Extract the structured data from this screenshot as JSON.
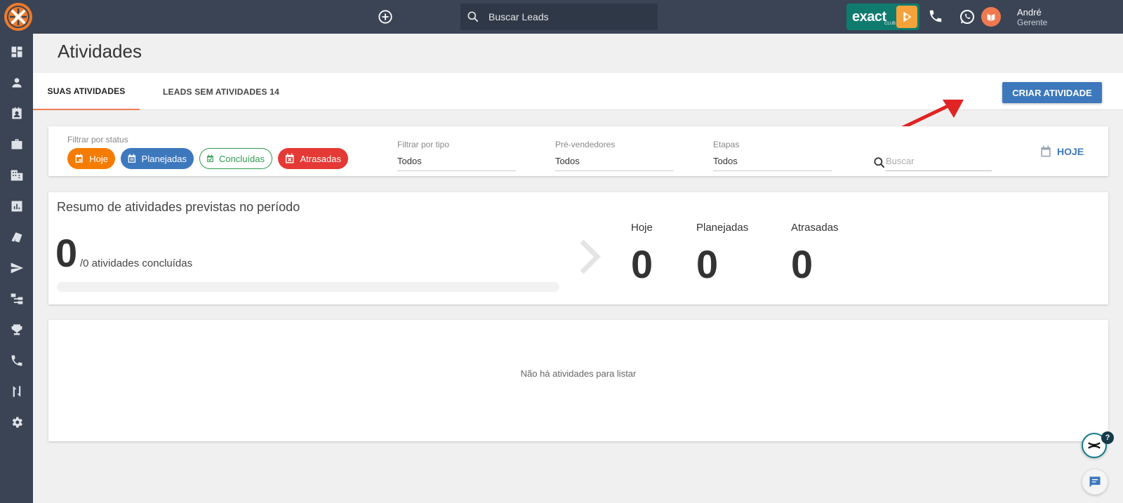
{
  "topbar": {
    "search_placeholder": "Buscar Leads",
    "brand_badge": "exact",
    "brand_badge_sub": "CLUB",
    "user_name": "André",
    "user_role": "Gerente"
  },
  "sidebar": {
    "items": [
      "dashboard-icon",
      "person-icon",
      "contact-card-icon",
      "briefcase-icon",
      "building-icon",
      "chart-icon",
      "tags-icon",
      "send-icon",
      "hierarchy-icon",
      "trophy-icon",
      "phone-icon",
      "sort-icon",
      "settings-icon"
    ]
  },
  "page": {
    "title": "Atividades"
  },
  "tabs": [
    {
      "label": "SUAS ATIVIDADES",
      "active": true
    },
    {
      "label": "LEADS SEM ATIVIDADES 14",
      "active": false
    }
  ],
  "actions": {
    "create_label": "CRIAR ATIVIDADE"
  },
  "filters": {
    "status_label": "Filtrar por status",
    "chips": {
      "hoje": "Hoje",
      "planejadas": "Planejadas",
      "concluidas": "Concluídas",
      "atrasadas": "Atrasadas"
    },
    "tipo_label": "Filtrar por tipo",
    "tipo_value": "Todos",
    "prevend_label": "Pré-vendedores",
    "prevend_value": "Todos",
    "etapas_label": "Etapas",
    "etapas_value": "Todos",
    "search_placeholder": "Buscar",
    "today_label": "HOJE"
  },
  "summary": {
    "title": "Resumo de atividades previstas no período",
    "completed": "0",
    "completed_suffix": "/0 atividades concluídas",
    "progress_percent": 0,
    "stats": [
      {
        "label": "Hoje",
        "value": "0"
      },
      {
        "label": "Planejadas",
        "value": "0"
      },
      {
        "label": "Atrasadas",
        "value": "0"
      }
    ]
  },
  "list": {
    "empty_message": "Não há atividades para listar"
  },
  "colors": {
    "topbar": "#3a4454",
    "accent_orange": "#f57c00",
    "primary_blue": "#3d78bd",
    "success_green": "#2e9a4e",
    "danger_red": "#e53935",
    "annotation_arrow": "#e02424"
  }
}
